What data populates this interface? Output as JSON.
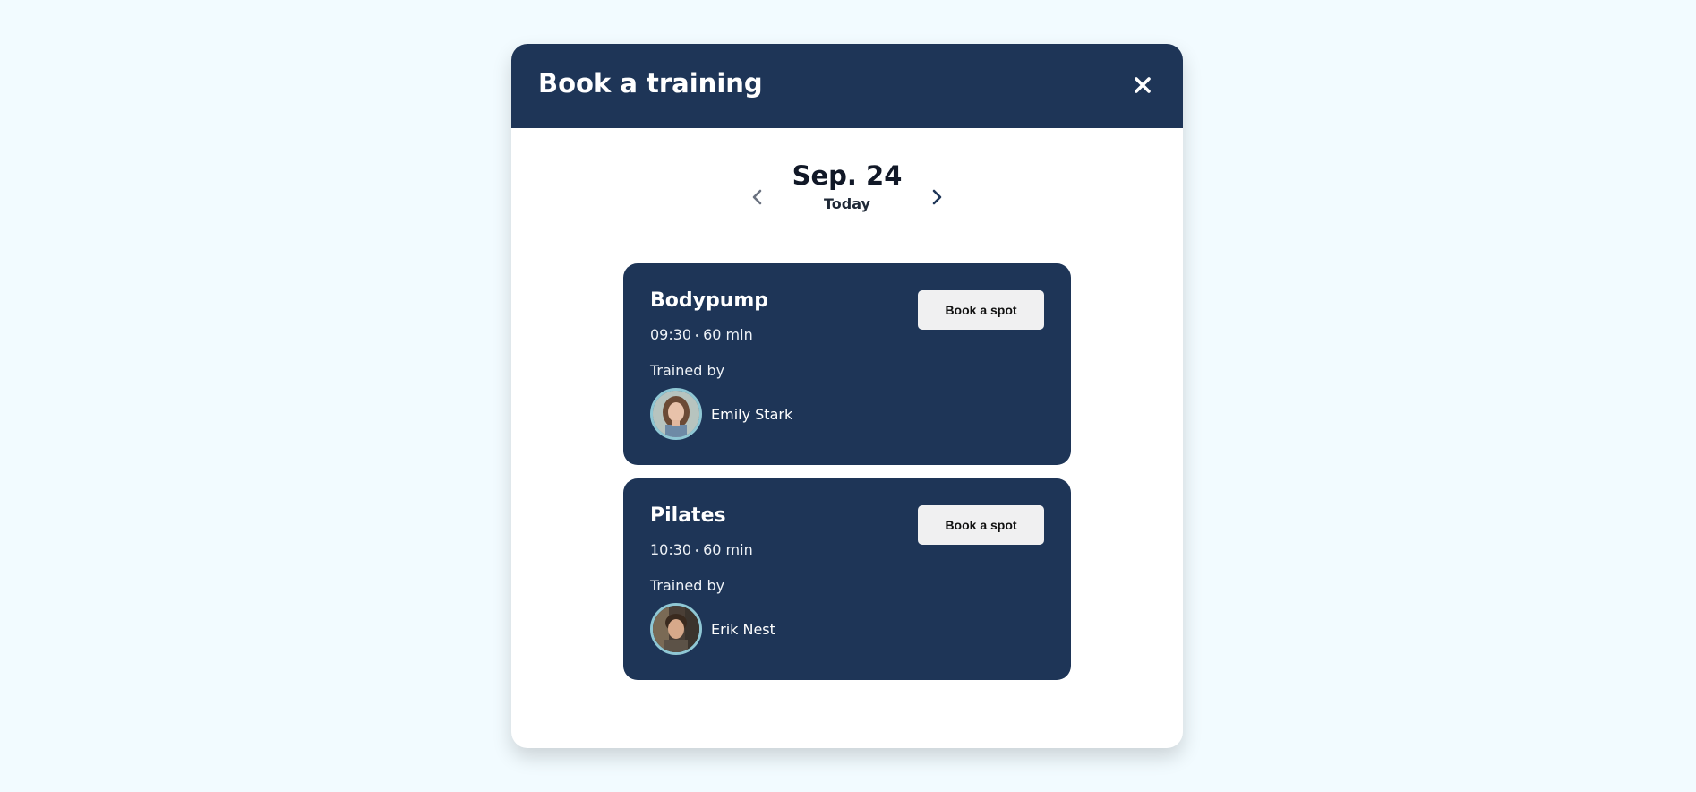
{
  "modal": {
    "title": "Book a training"
  },
  "date_nav": {
    "date": "Sep. 24",
    "label": "Today"
  },
  "colors": {
    "page_background": "#f2fbff",
    "header_background": "#1e3557",
    "card_background": "#1e3557",
    "button_background": "#f0f0f1",
    "avatar_ring": "#8fc7d4"
  },
  "icons": {
    "close": "close-icon",
    "prev": "chevron-left-icon",
    "next": "chevron-right-icon"
  },
  "trainings": [
    {
      "name": "Bodypump",
      "time": "09:30",
      "duration": "60 min",
      "trained_by_label": "Trained by",
      "trainer": "Emily Stark",
      "button_label": "Book a spot"
    },
    {
      "name": "Pilates",
      "time": "10:30",
      "duration": "60 min",
      "trained_by_label": "Trained by",
      "trainer": "Erik Nest",
      "button_label": "Book a spot"
    }
  ]
}
